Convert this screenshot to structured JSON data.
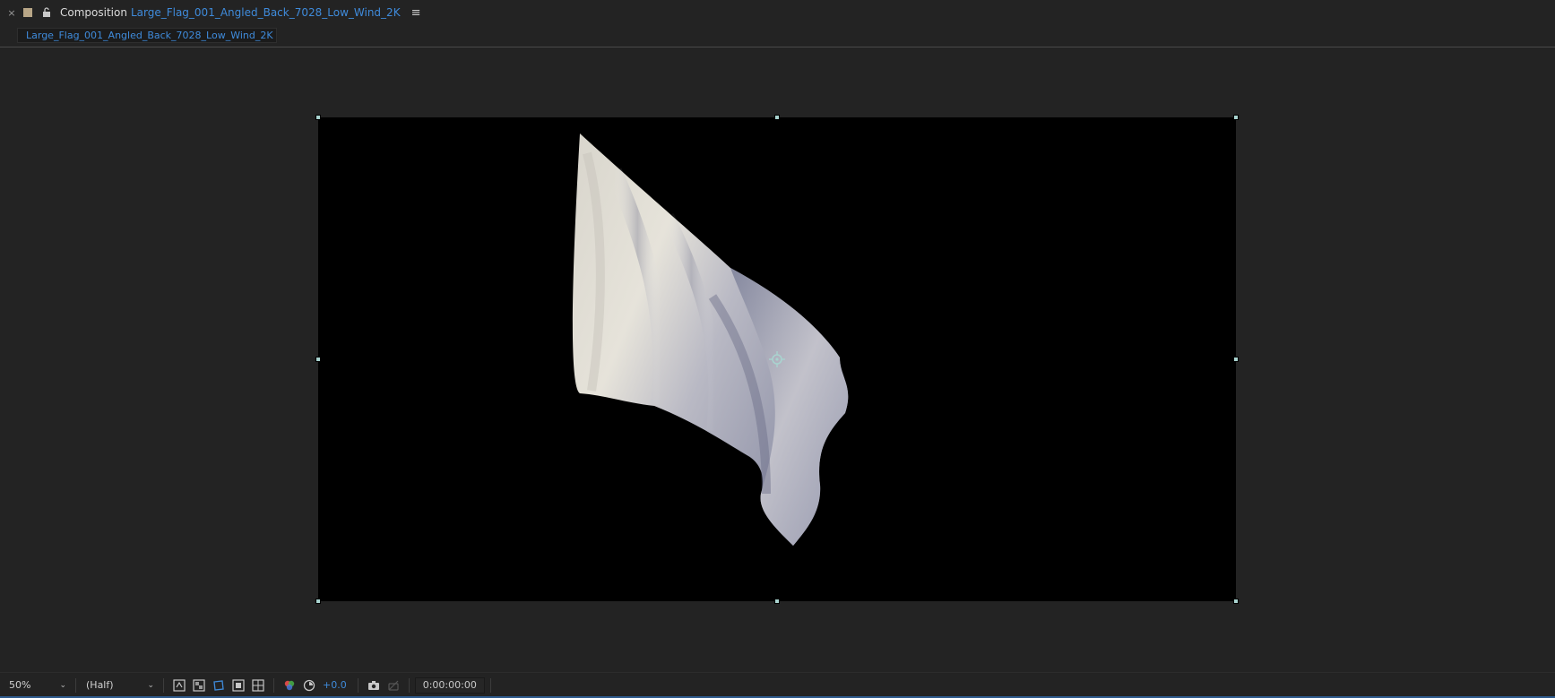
{
  "panel": {
    "close_glyph": "×",
    "title_label": "Composition",
    "comp_name": "Large_Flag_001_Angled_Back_7028_Low_Wind_2K",
    "menu_glyph": "≡",
    "label_color": "#b8a687"
  },
  "tab": {
    "label": "Large_Flag_001_Angled_Back_7028_Low_Wind_2K"
  },
  "toolbar": {
    "magnification": "50%",
    "resolution": "(Half)",
    "exposure": "+0.0",
    "timecode": "0:00:00:00",
    "icons": [
      "always-preview-icon",
      "transparency-grid-icon",
      "mask-visibility-icon",
      "region-of-interest-icon",
      "grid-guides-icon",
      "channel-icon",
      "reset-exposure-icon",
      "snapshot-camera-icon",
      "show-snapshot-icon"
    ]
  },
  "colors": {
    "accent": "#3f8bdb",
    "panel_bg": "#232323",
    "handle": "#a9d3cf",
    "canvas": "#000000"
  }
}
